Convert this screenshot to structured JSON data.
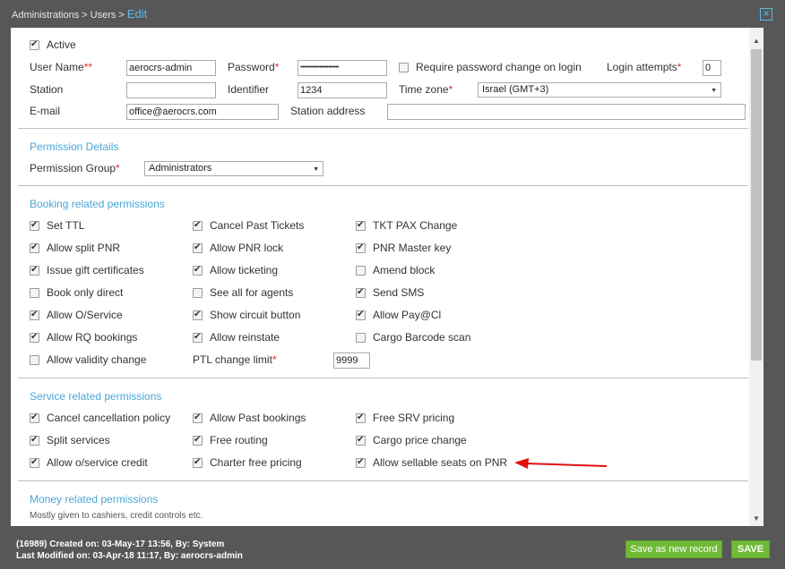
{
  "breadcrumb": {
    "level1": "Administrations",
    "sep": ">",
    "level2": "Users",
    "current": "Edit"
  },
  "window": {
    "close_symbol": "×"
  },
  "user": {
    "active_label": "Active",
    "username_label": "User Name",
    "username_value": "aerocrs-admin",
    "password_label": "Password",
    "password_value": "••••••••••••••••••••••",
    "require_pw_label": "Require password change on login",
    "login_attempts_label": "Login attempts",
    "login_attempts_value": "0",
    "station_label": "Station",
    "station_value": "",
    "identifier_label": "Identifier",
    "identifier_value": "1234",
    "timezone_label": "Time zone",
    "timezone_value": "Israel (GMT+3)",
    "email_label": "E-mail",
    "email_value": "office@aerocrs.com",
    "station_address_label": "Station address",
    "station_address_value": "",
    "required_mark": "*",
    "username_required_mark": "**"
  },
  "permission_details": {
    "title": "Permission Details",
    "group_label": "Permission Group",
    "group_value": "Administrators"
  },
  "booking": {
    "title": "Booking related permissions",
    "col1": [
      {
        "label": "Set TTL",
        "checked": true
      },
      {
        "label": "Allow split PNR",
        "checked": true
      },
      {
        "label": "Issue gift certificates",
        "checked": true
      },
      {
        "label": "Book only direct",
        "checked": false
      },
      {
        "label": "Allow O/Service",
        "checked": true
      },
      {
        "label": "Allow RQ bookings",
        "checked": true
      },
      {
        "label": "Allow validity change",
        "checked": false
      }
    ],
    "col2": [
      {
        "label": "Cancel Past Tickets",
        "checked": true
      },
      {
        "label": "Allow PNR lock",
        "checked": true
      },
      {
        "label": "Allow ticketing",
        "checked": true
      },
      {
        "label": "See all for agents",
        "checked": false
      },
      {
        "label": "Show circuit button",
        "checked": true
      },
      {
        "label": "Allow reinstate",
        "checked": true
      }
    ],
    "col3": [
      {
        "label": "TKT PAX Change",
        "checked": true
      },
      {
        "label": "PNR Master key",
        "checked": true
      },
      {
        "label": "Amend block",
        "checked": false
      },
      {
        "label": "Send SMS",
        "checked": true
      },
      {
        "label": "Allow Pay@Cl",
        "checked": true
      },
      {
        "label": "Cargo Barcode scan",
        "checked": false
      }
    ],
    "ptl_label": "PTL change limit",
    "ptl_value": "9999"
  },
  "service": {
    "title": "Service related permissions",
    "col1": [
      {
        "label": "Cancel cancellation policy",
        "checked": true
      },
      {
        "label": "Split services",
        "checked": true
      },
      {
        "label": "Allow o/service credit",
        "checked": true
      }
    ],
    "col2": [
      {
        "label": "Allow Past bookings",
        "checked": true
      },
      {
        "label": "Free routing",
        "checked": true
      },
      {
        "label": "Charter free pricing",
        "checked": true
      }
    ],
    "col3": [
      {
        "label": "Free SRV pricing",
        "checked": true
      },
      {
        "label": "Cargo price change",
        "checked": true
      },
      {
        "label": "Allow sellable seats on PNR",
        "checked": true
      }
    ]
  },
  "money": {
    "title": "Money related permissions",
    "note": "Mostly given to cashiers, credit controls etc."
  },
  "footer": {
    "created": "(16989) Created on: 03-May-17 13:56, By: System",
    "modified": "Last Modified on: 03-Apr-18 11:17, By: aerocrs-admin",
    "save_new_label": "Save as new record",
    "save_label": "SAVE"
  },
  "colors": {
    "accent": "#4aa6d8",
    "save_green": "#6fba36",
    "arrow_red": "#e01010"
  },
  "icons": {
    "check": "check-icon",
    "close": "close-icon",
    "dropdown": "dropdown-arrow-icon",
    "annotation": "red-arrow-annotation"
  }
}
